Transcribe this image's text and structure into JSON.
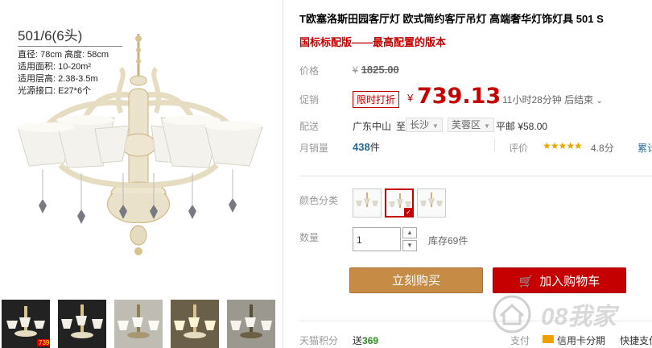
{
  "spec": {
    "title": "501/6(6头)",
    "lines": [
      "直径: 78cm  高度: 58cm",
      "适用面积: 10-20m²",
      "适用层高: 2.38-3.5m",
      "光源接口: E27*6个"
    ]
  },
  "thumbnails": [
    {
      "name": "thumb-1",
      "badge": "739"
    },
    {
      "name": "thumb-2"
    },
    {
      "name": "thumb-3"
    },
    {
      "name": "thumb-4"
    },
    {
      "name": "thumb-5"
    }
  ],
  "product": {
    "title": "T欧塞洛斯田园客厅灯 欧式简约客厅吊灯 高端奢华灯饰灯具 501 S",
    "subtitle": "国标标配版——最高配置的版本"
  },
  "price": {
    "label": "价格",
    "yen": "¥",
    "original": "1825.00"
  },
  "promo": {
    "label": "促销",
    "tag": "限时打折",
    "yen": "¥",
    "price": "739.13",
    "countdown": "11小时28分钟 后结束"
  },
  "shipping": {
    "label": "配送",
    "from": "广东中山",
    "to_label": "至",
    "city": "长沙",
    "district": "芙蓉区",
    "fee": "平邮 ¥58.00"
  },
  "sales": {
    "label": "月销量",
    "count": "438",
    "unit": "件",
    "review_label": "评价",
    "stars": "★★★★★",
    "score": "4.8分",
    "review_link": "累计评价"
  },
  "options": {
    "color_label": "颜色分类",
    "qty_label": "数量",
    "qty_value": "1",
    "stock": "库存69件"
  },
  "actions": {
    "buy": "立刻购买",
    "cart": "加入购物车"
  },
  "footer": {
    "points_label": "天猫积分",
    "points_prefix": "送",
    "points_value": "369",
    "pay_label": "支付",
    "credit": "信用卡分期",
    "express": "快捷支付"
  },
  "watermark": {
    "text": "08我家"
  },
  "colors": {
    "accent_red": "#c40000",
    "buy_orange": "#c68b45",
    "link_blue": "#2a6a99",
    "points_green": "#2d8a20"
  }
}
